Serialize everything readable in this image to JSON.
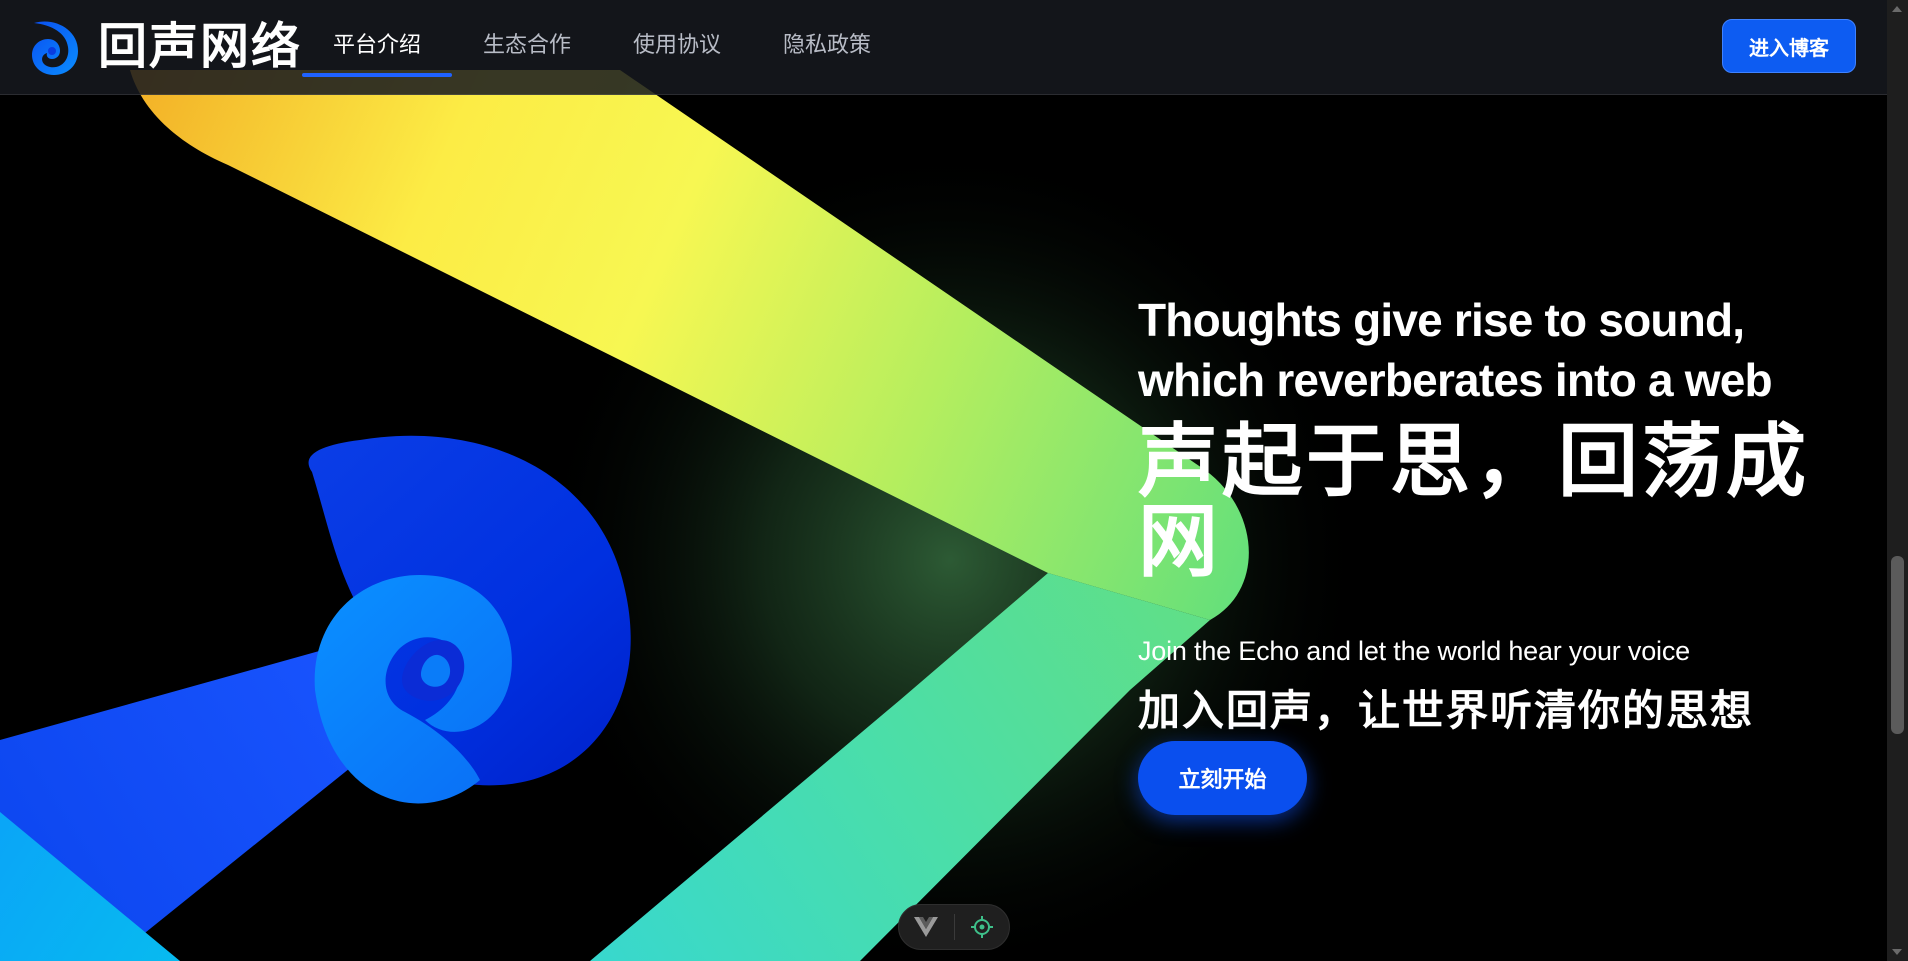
{
  "header": {
    "logo_text": "回声网络",
    "nav_items": [
      {
        "label": "平台介绍",
        "active": true
      },
      {
        "label": "生态合作",
        "active": false
      },
      {
        "label": "使用协议",
        "active": false
      },
      {
        "label": "隐私政策",
        "active": false
      }
    ],
    "enter_button": "进入博客"
  },
  "hero": {
    "slogan_en_line1": "Thoughts give rise to sound,",
    "slogan_en_line2": "which reverberates into a web",
    "slogan_zh": "声起于思，回荡成网",
    "sub_en": "Join the Echo and let the world hear your voice",
    "sub_zh": "加入回声，让世界听清你的思想",
    "start_button": "立刻开始"
  },
  "devtools": {
    "items": [
      "vue-devtools-icon",
      "inspect-target-icon"
    ]
  },
  "colors": {
    "accent": "#0d5cf2",
    "nav_underline": "#1f62ff",
    "yellow": "#f9f54d",
    "green": "#63e07f",
    "teal": "#3ad8c8",
    "blue": "#0a3fe8",
    "light_blue": "#0a8bff"
  }
}
